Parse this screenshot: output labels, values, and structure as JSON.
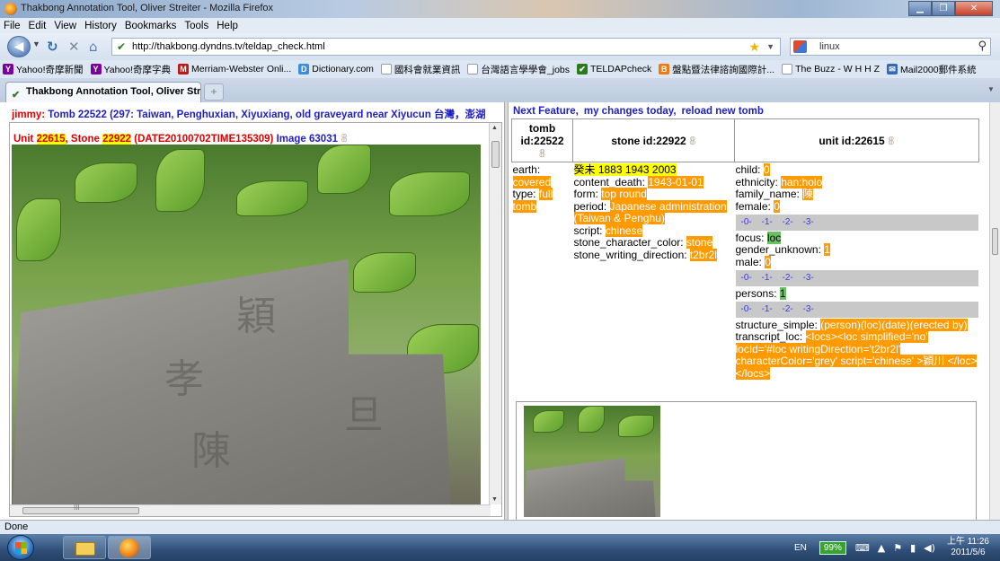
{
  "window": {
    "title": "Thakbong Annotation Tool, Oliver Streiter - Mozilla Firefox"
  },
  "menu": [
    "File",
    "Edit",
    "View",
    "History",
    "Bookmarks",
    "Tools",
    "Help"
  ],
  "nav": {
    "url": "http://thakbong.dyndns.tv/teldap_check.html",
    "search_value": "linux"
  },
  "bookmarks": [
    {
      "label": "Yahoo!奇摩新聞",
      "icon": "yahoo-icon",
      "color": "#7b0099"
    },
    {
      "label": "Yahoo!奇摩字典",
      "icon": "yahoo-icon",
      "color": "#7b0099"
    },
    {
      "label": "Merriam-Webster Onli...",
      "icon": "mw-icon",
      "color": "#c01717"
    },
    {
      "label": "Dictionary.com",
      "icon": "dictionary-icon",
      "color": "#3a8fd8"
    },
    {
      "label": "國科會就業資訊",
      "icon": "page-icon",
      "color": "#cfd8e3"
    },
    {
      "label": "台灣語言學學會_jobs",
      "icon": "page-icon",
      "color": "#cfd8e3"
    },
    {
      "label": "TELDAPcheck",
      "icon": "leaf-icon",
      "color": "#2d7a1d"
    },
    {
      "label": "盤點暨法律諮詢國際計...",
      "icon": "orange-b-icon",
      "color": "#f07a10"
    },
    {
      "label": "The Buzz - W H H Z",
      "icon": "page-icon",
      "color": "#cfd8e3"
    },
    {
      "label": "Mail2000郵件系統",
      "icon": "mail-icon",
      "color": "#3468b8"
    }
  ],
  "tab": {
    "label": "Thakbong Annotation Tool, Oliver Str..."
  },
  "left": {
    "user": "jimmy:",
    "tomb_line": " Tomb 22522 (297: Taiwan, Penghuxian, Xiyuxiang, old graveyard near Xiyucun 台灣，澎湖",
    "unit_prefix": "Unit ",
    "unit_id": "22615",
    "stone_prefix": ", Stone ",
    "stone_id": "22922",
    "date_part": " (DATE20100702TIME135309)",
    "image_label": " Image 63031"
  },
  "right": {
    "links": [
      "Next Feature,",
      "my changes today,",
      "reload new tomb"
    ],
    "headers": {
      "tomb": "tomb id:22522",
      "stone": "stone id:22922",
      "unit": "unit id:22615"
    },
    "tomb_attrs": [
      {
        "key": "earth:",
        "value": "covered"
      },
      {
        "key": "type:",
        "value": "full tomb"
      }
    ],
    "stone_date_line": "癸未 1883 1943 2003",
    "stone_attrs": [
      {
        "key": "content_death:",
        "value": "1943-01-01"
      },
      {
        "key": "form:",
        "value": "top round"
      },
      {
        "key": "period:",
        "value": "Japanese administration (Taiwan & Penghu)"
      },
      {
        "key": "script:",
        "value": "chinese"
      },
      {
        "key": "stone_character_color:",
        "value": "stone"
      },
      {
        "key": "stone_writing_direction:",
        "value": "t2br2l"
      }
    ],
    "unit_attrs": {
      "child": {
        "key": "child:",
        "value": "0"
      },
      "ethnicity": {
        "key": "ethnicity:",
        "value": "han:holo"
      },
      "family_name": {
        "key": "family_name:",
        "value": "陳"
      },
      "female": {
        "key": "female:",
        "value": "0"
      },
      "focus": {
        "key": "focus:",
        "value": "loc"
      },
      "gender_unknown": {
        "key": "gender_unknown:",
        "value": "1"
      },
      "male": {
        "key": "male:",
        "value": "0"
      },
      "persons": {
        "key": "persons:",
        "value": "1"
      },
      "structure_simple": {
        "key": "structure_simple:",
        "value": "(person)(loc)(date)(erected by)"
      },
      "transcript_loc": {
        "key": "transcript_loc:",
        "value": "<locs><loc simplified='no' locId='#loc writingDirection='t2br2l' characterColor='grey' script='chinese' >穎川 </loc></locs>"
      }
    },
    "scale": "-0- -1- -2- -3-"
  },
  "status": "Done",
  "tray": {
    "lang": "EN",
    "battery": "99%",
    "time": "上午 11:26",
    "date": "2011/5/6"
  }
}
